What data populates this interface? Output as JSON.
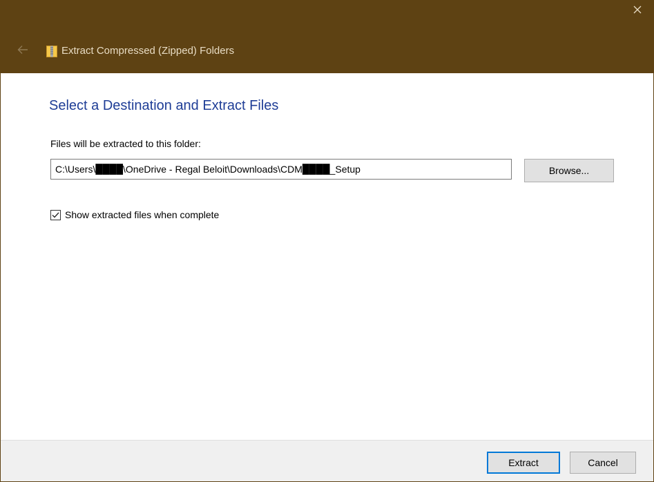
{
  "window": {
    "title": "Extract Compressed (Zipped) Folders",
    "titlebar_color": "#5e4213",
    "icons": {
      "close": "close-icon",
      "back": "back-arrow-icon",
      "app": "zip-folder-icon"
    }
  },
  "main": {
    "heading": "Select a Destination and Extract Files",
    "heading_color": "#1e3d96",
    "path_label": "Files will be extracted to this folder:",
    "path_value": "C:\\Users\\████\\OneDrive - Regal Beloit\\Downloads\\CDM████_Setup",
    "browse_label": "Browse...",
    "checkbox_label": "Show extracted files when complete",
    "checkbox_checked": true
  },
  "footer": {
    "extract_label": "Extract",
    "cancel_label": "Cancel",
    "accent_color": "#0078d7"
  }
}
